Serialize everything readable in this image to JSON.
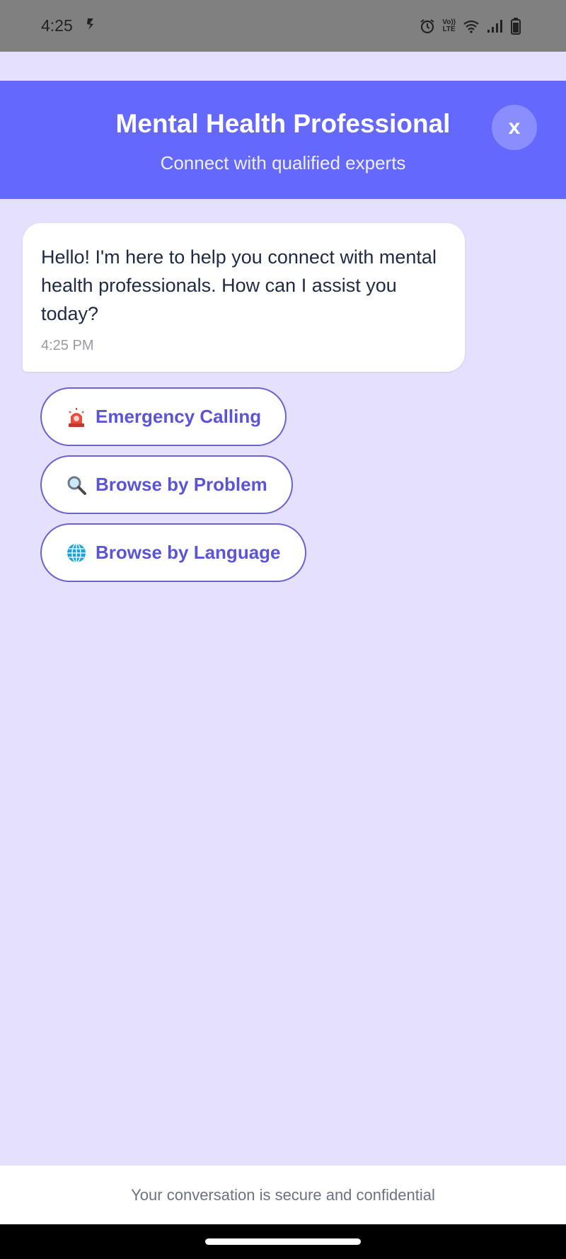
{
  "status_bar": {
    "time": "4:25",
    "lte_top": "Vo))",
    "lte_bottom": "LTE"
  },
  "header": {
    "title": "Mental Health Professional",
    "subtitle": "Connect with qualified experts",
    "close_label": "x"
  },
  "chat": {
    "message": "Hello! I'm here to help you connect with mental health professionals. How can I assist you today?",
    "timestamp": "4:25 PM"
  },
  "options": [
    {
      "label": "Emergency Calling",
      "icon": "siren-icon"
    },
    {
      "label": "Browse by Problem",
      "icon": "magnifier-icon"
    },
    {
      "label": "Browse by Language",
      "icon": "globe-icon"
    }
  ],
  "footer": {
    "text": "Your conversation is secure and confidential"
  },
  "colors": {
    "header": "#6468fd",
    "background": "#e4e0fd",
    "accent": "#5b55d6"
  }
}
